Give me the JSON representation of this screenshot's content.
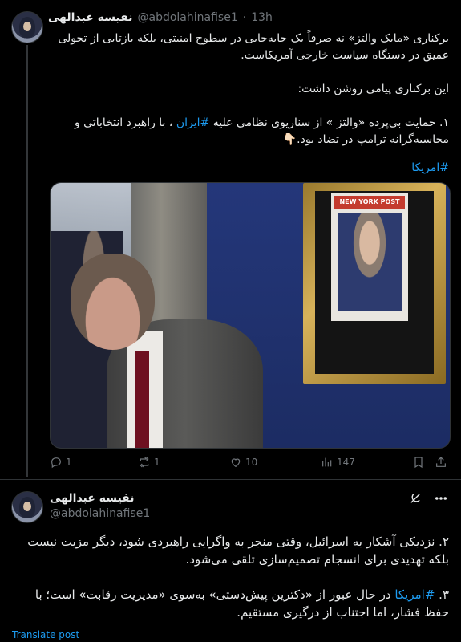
{
  "tweet1": {
    "author_name": "نفیسه عبدالهی",
    "handle": "@abdolahinafise1",
    "separator": "·",
    "time": "13h",
    "paragraphs": [
      "برکناری «مایک والتز» نه صرفاً یک جابه‌جایی در سطوح امنیتی، بلکه بازتابی از تحولی عمیق در دستگاه سیاست خارجی آمریکاست.",
      "این برکناری پیامی روشن داشت:"
    ],
    "point1_before": "۱. حمایت بی‌پرده «والتز » از سناریوی نظامی علیه ",
    "point1_tag": "#ایران",
    "point1_after": " ، با راهبرد انتخاباتی و محاسبه‌گرانه ترامپ در تضاد بود.👇🏻",
    "hashtag": "#امریکا",
    "media_poster_text": "NEW YORK POST",
    "stats": {
      "replies": "1",
      "reposts": "1",
      "likes": "10",
      "views": "147"
    }
  },
  "tweet2": {
    "author_name": "نفیسه عبدالهی",
    "handle": "@abdolahinafise1",
    "point2": "۲. نزدیکی آشکار به اسرائیل، وقتی منجر به واگرایی راهبردی شود، دیگر مزیت نیست بلکه تهدیدی برای انسجام تصمیم‌سازی تلقی می‌شود.",
    "point3_before": "۳. ",
    "point3_tag": "#امریکا",
    "point3_after": " در حال عبور از «دکترین پیش‌دستی» به‌سوی «مدیریت رقابت» است؛ با حفظ فشار، اما اجتناب از درگیری مستقیم.",
    "translate_label": "Translate post"
  },
  "icons": [
    "reply-icon",
    "repost-icon",
    "like-icon",
    "views-icon",
    "bookmark-icon",
    "share-icon",
    "grok-icon",
    "more-icon"
  ],
  "colors": {
    "background": "#000000",
    "text": "#e7e9ea",
    "secondary": "#71767b",
    "accent": "#1d9bf0"
  }
}
